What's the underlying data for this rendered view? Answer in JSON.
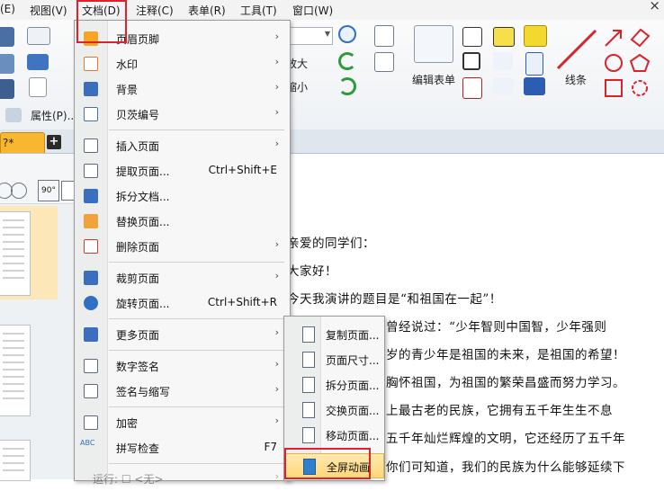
{
  "menubar": {
    "items": [
      "(E)",
      "视图(V)",
      "文档(D)",
      "注释(C)",
      "表单(R)",
      "工具(T)",
      "窗口(W)"
    ],
    "close_glyph": "×"
  },
  "ribbon": {
    "zoom_in_label": "放大",
    "zoom_out_label": "缩小",
    "edit_form_label": "编辑表单",
    "line_label": "线条",
    "properties_label": "属性(P)..."
  },
  "tab": {
    "title": "?*",
    "new_tab": "+"
  },
  "left_tools": {
    "rotate_label": "90°"
  },
  "document": {
    "lines": [
      "亲爱的同学们：",
      "大家好！",
      "今天我演讲的题目是“和祖国在一起”！",
      "曾经说过：“少年智则中国智，少年强则",
      "岁的青少年是祖国的未来，是祖国的希望！",
      "胸怀祖国，为祖国的繁荣昌盛而努力学习。",
      "上最古老的民族，它拥有五千年生生不息",
      "五千年灿烂辉煌的文明，它还经历了五千年",
      "你们可知道，我们的民族为什么能够延续下"
    ]
  },
  "menu": {
    "items": [
      {
        "label": "页眉页脚",
        "shortcut": "",
        "submenu": true,
        "icon": "header-footer-icon"
      },
      {
        "label": "水印",
        "shortcut": "",
        "submenu": true,
        "icon": "watermark-icon"
      },
      {
        "label": "背景",
        "shortcut": "",
        "submenu": true,
        "icon": "background-icon"
      },
      {
        "label": "贝茨编号",
        "shortcut": "",
        "submenu": true,
        "icon": "bates-number-icon"
      },
      {
        "label": "插入页面",
        "shortcut": "",
        "submenu": true,
        "icon": "insert-page-icon"
      },
      {
        "label": "提取页面...",
        "shortcut": "Ctrl+Shift+E",
        "submenu": false,
        "icon": "extract-page-icon"
      },
      {
        "label": "拆分文档...",
        "shortcut": "",
        "submenu": false,
        "icon": "split-document-icon"
      },
      {
        "label": "替换页面...",
        "shortcut": "",
        "submenu": false,
        "icon": "replace-page-icon"
      },
      {
        "label": "删除页面",
        "shortcut": "",
        "submenu": true,
        "icon": "delete-page-icon"
      },
      {
        "label": "裁剪页面",
        "shortcut": "",
        "submenu": true,
        "icon": "crop-page-icon"
      },
      {
        "label": "旋转页面...",
        "shortcut": "Ctrl+Shift+R",
        "submenu": false,
        "icon": "rotate-page-icon"
      },
      {
        "label": "更多页面",
        "shortcut": "",
        "submenu": true,
        "icon": "more-pages-icon"
      },
      {
        "label": "数字签名",
        "shortcut": "",
        "submenu": true,
        "icon": "digital-signature-icon"
      },
      {
        "label": "签名与缩写",
        "shortcut": "",
        "submenu": true,
        "icon": "sign-initial-icon"
      },
      {
        "label": "加密",
        "shortcut": "",
        "submenu": true,
        "icon": "encrypt-icon"
      },
      {
        "label": "拼写检查",
        "shortcut": "F7",
        "submenu": false,
        "icon": "spell-check-icon"
      },
      {
        "label": "运行: ☐ <无>",
        "shortcut": "",
        "submenu": true,
        "icon": "run-icon"
      }
    ],
    "abc_label": "ABC",
    "arrow_glyph": "›"
  },
  "submenu": {
    "items": [
      {
        "label": "复制页面..."
      },
      {
        "label": "页面尺寸..."
      },
      {
        "label": "拆分页面..."
      },
      {
        "label": "交换页面..."
      },
      {
        "label": "移动页面..."
      },
      {
        "label": "全屏动画"
      }
    ]
  },
  "colors": {
    "highlight_red": "#e0202a",
    "menu_hover": "#ffd777",
    "tab_orange": "#f7b731"
  }
}
